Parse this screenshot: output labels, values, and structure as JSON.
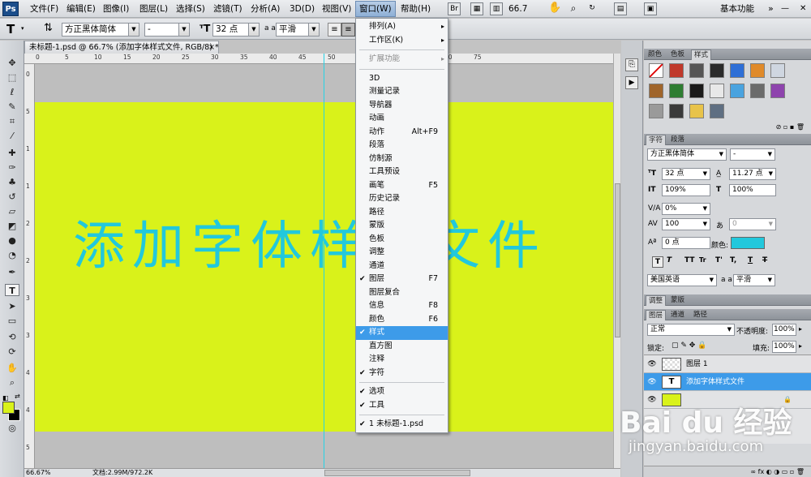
{
  "app": {
    "logo": "Ps"
  },
  "menubar": {
    "items": [
      "文件(F)",
      "编辑(E)",
      "图像(I)",
      "图层(L)",
      "选择(S)",
      "滤镜(T)",
      "分析(A)",
      "3D(D)",
      "视图(V)",
      "窗口(W)",
      "帮助(H)"
    ],
    "zoom": "66.7",
    "workspace": "基本功能"
  },
  "options": {
    "font_family": "方正黑体简体",
    "font_style": "-",
    "font_size": "32 点",
    "aa_label": "a a",
    "antialias": "平滑"
  },
  "document": {
    "tab_title": "未标题-1.psd @ 66.7% (添加字体样式文件, RGB/8) *",
    "canvas_text": "添加字体样式文件",
    "canvas_color": "#d9f21a",
    "text_color": "#22c8dc",
    "ruler_h": [
      "0",
      "5",
      "10",
      "15",
      "20",
      "25",
      "30",
      "35",
      "40",
      "45",
      "50",
      "55",
      "60",
      "65",
      "70",
      "75"
    ],
    "ruler_v": [
      "0",
      "5",
      "1",
      "1",
      "2",
      "2",
      "3",
      "3",
      "4",
      "4",
      "5"
    ],
    "status_zoom": "66.67%",
    "status_doc": "文档:2.99M/972.2K"
  },
  "window_menu": {
    "items": [
      {
        "label": "排列(A)",
        "arrow": "▸"
      },
      {
        "label": "工作区(K)",
        "arrow": "▸"
      },
      {
        "sep": true
      },
      {
        "label": "扩展功能",
        "arrow": "▸",
        "disabled": true
      },
      {
        "sep": true
      },
      {
        "label": "3D"
      },
      {
        "label": "测量记录"
      },
      {
        "label": "导航器"
      },
      {
        "label": "动画"
      },
      {
        "label": "动作",
        "shortcut": "Alt+F9"
      },
      {
        "label": "段落"
      },
      {
        "label": "仿制源"
      },
      {
        "label": "工具预设"
      },
      {
        "label": "画笔",
        "shortcut": "F5"
      },
      {
        "label": "历史记录"
      },
      {
        "label": "路径"
      },
      {
        "label": "蒙版"
      },
      {
        "label": "色板"
      },
      {
        "label": "调整"
      },
      {
        "label": "通道"
      },
      {
        "label": "图层",
        "shortcut": "F7",
        "checked": true
      },
      {
        "label": "图层复合"
      },
      {
        "label": "信息",
        "shortcut": "F8"
      },
      {
        "label": "颜色",
        "shortcut": "F6"
      },
      {
        "label": "样式",
        "checked": true,
        "highlight": true
      },
      {
        "label": "直方图"
      },
      {
        "label": "注释"
      },
      {
        "label": "字符",
        "checked": true
      },
      {
        "sep": true
      },
      {
        "label": "选项",
        "checked": true
      },
      {
        "label": "工具",
        "checked": true
      },
      {
        "sep": true
      },
      {
        "label": "1 未标题-1.psd",
        "checked": true
      }
    ]
  },
  "styles_panel": {
    "tabs": [
      "颜色",
      "色板",
      "样式"
    ],
    "swatches": [
      "#ffffff",
      "#c0392b",
      "#555555",
      "#2b2b2b",
      "#2e6fd6",
      "#e08a2a",
      "#cfd6e0",
      "#a0652b",
      "#2e7d32",
      "#1a1a1a",
      "#e8e8e8",
      "#4aa3df",
      "#6b6b6b",
      "#8e44ad",
      "#9a9a9a",
      "#3a3a3a",
      "#e8c34a",
      "#5f6f82"
    ]
  },
  "character_panel": {
    "tabs": [
      "字符",
      "段落"
    ],
    "font_family": "方正黑体简体",
    "font_style": "-",
    "size": "32 点",
    "leading": "11.27 点",
    "vscale": "109%",
    "hscale": "100%",
    "kerning": "0%",
    "tracking": "100",
    "tracking2": "0",
    "baseline": "0 点",
    "color_label": "颜色:",
    "color": "#22c8dc",
    "styles": [
      "T",
      "T",
      "TT",
      "Tr",
      "T'",
      "T,",
      "T",
      "T"
    ],
    "language": "美国英语",
    "aa_label": "a a",
    "antialias": "平滑"
  },
  "adjust_panel": {
    "tabs": [
      "调整",
      "蒙版"
    ]
  },
  "layers_panel": {
    "tabs": [
      "图层",
      "通道",
      "路径"
    ],
    "blend": "正常",
    "opacity_label": "不透明度:",
    "opacity": "100%",
    "lock_label": "锁定:",
    "fill_label": "填充:",
    "fill": "100%",
    "layers": [
      {
        "name": "图层 1",
        "selected": false
      },
      {
        "name": "添加字体样式文件",
        "selected": true
      },
      {
        "name": "",
        "selected": false
      }
    ]
  },
  "watermark": {
    "text": "Bai du 经验",
    "url": "jingyan.baidu.com"
  }
}
